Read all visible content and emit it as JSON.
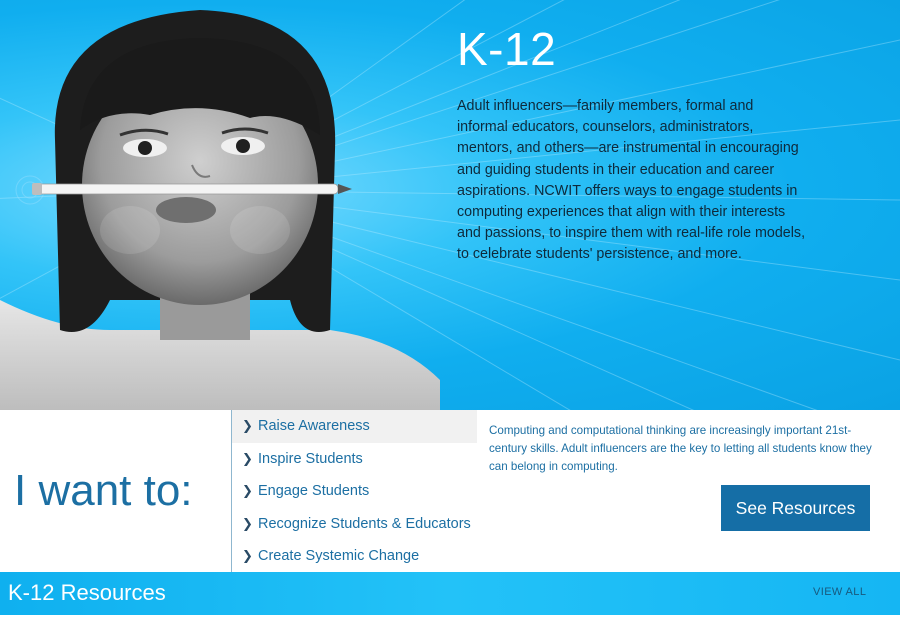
{
  "hero": {
    "title": "K-12",
    "description": "Adult influencers—family members, formal and informal educators, counselors, administrators, mentors, and others—are instrumental in encouraging and guiding students in their education and career aspirations. NCWIT offers ways to engage students in computing experiences that align with their interests and passions, to inspire them with real-life role models, to celebrate students' persistence, and more."
  },
  "want": {
    "label": "I want to:",
    "items": [
      {
        "label": "Raise Awareness",
        "active": true
      },
      {
        "label": "Inspire Students",
        "active": false
      },
      {
        "label": "Engage Students",
        "active": false
      },
      {
        "label": "Recognize Students & Educators",
        "active": false
      },
      {
        "label": "Create Systemic Change",
        "active": false
      }
    ],
    "description": "Computing and computational thinking are increasingly important 21st-century skills. Adult influencers are the key to letting all students know they can belong in computing.",
    "button_label": "See Resources"
  },
  "resources": {
    "title": "K-12 Resources",
    "view_all": "VIEW ALL"
  },
  "colors": {
    "accent_blue": "#1c6fa3",
    "button_blue": "#156ea6",
    "hero_cyan": "#10aeef"
  },
  "icons": {
    "menu_chevron": "chevron-right-icon"
  }
}
